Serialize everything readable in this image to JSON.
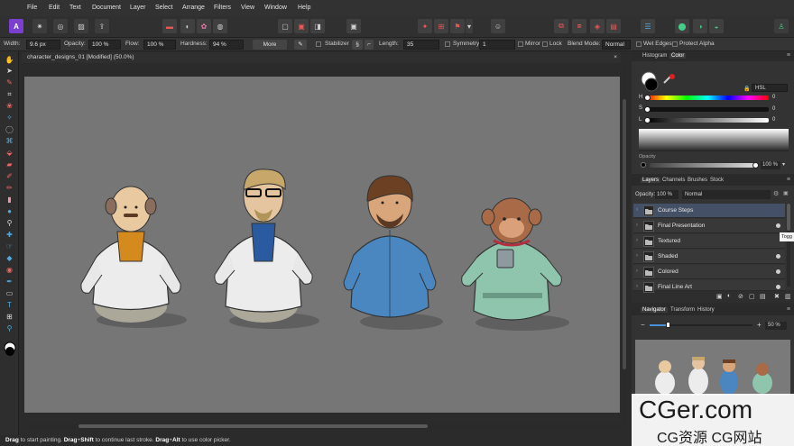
{
  "menu": [
    "File",
    "Edit",
    "Text",
    "Document",
    "Layer",
    "Select",
    "Arrange",
    "Filters",
    "View",
    "Window",
    "Help"
  ],
  "context_toolbar": {
    "width_label": "Width:",
    "width_value": "9.6 px",
    "opacity_label": "Opacity:",
    "opacity_value": "100 %",
    "flow_label": "Flow:",
    "flow_value": "100 %",
    "hardness_label": "Hardness:",
    "hardness_value": "94 %",
    "more_label": "More",
    "stabilizer_label": "Stabilizer",
    "length_label": "Length:",
    "length_value": "35",
    "symmetry_label": "Symmetry",
    "symmetry_value": "1",
    "mirror_label": "Mirror",
    "lock_label": "Lock",
    "blend_label": "Blend Mode:",
    "blend_value": "Normal",
    "wet_edges_label": "Wet Edges",
    "protect_alpha_label": "Protect Alpha"
  },
  "document": {
    "tab_title": "character_designs_01 [Modified] (50.0%)",
    "close": "×"
  },
  "status_bar": {
    "b1": "Drag",
    "t1": " to start painting. ",
    "b2": "Drag",
    "t2": "+",
    "b3": "Shift",
    "t3": " to continue last stroke. ",
    "b4": "Drag",
    "t4": "+",
    "b5": "Alt",
    "t5": " to use color picker."
  },
  "color_panel": {
    "tabs": [
      "Histogram",
      "Color"
    ],
    "active_tab": "Color",
    "model": "HSL",
    "h_label": "H",
    "h_value": "0",
    "s_label": "S",
    "s_value": "0",
    "l_label": "L",
    "l_value": "0",
    "opacity_label": "Opacity",
    "opacity_value": "100 %",
    "opacity_fraction": 1.0,
    "fill_color": "#ffffff",
    "stroke_color": "#000000",
    "accent_color": "#e02020"
  },
  "layers_panel": {
    "tabs": [
      "Layers",
      "Channels",
      "Brushes",
      "Stock"
    ],
    "active_tab": "Layers",
    "opacity_label": "Opacity:",
    "opacity_value": "100 %",
    "blend_value": "Normal",
    "layers": [
      {
        "name": "Course Steps",
        "selected": true
      },
      {
        "name": "Final Presentation",
        "selected": false
      },
      {
        "name": "Textured",
        "selected": false
      },
      {
        "name": "Shaded",
        "selected": false
      },
      {
        "name": "Colored",
        "selected": false
      },
      {
        "name": "Final Line Art",
        "selected": false
      }
    ],
    "tooltip": "Togg"
  },
  "navigator_panel": {
    "tabs": [
      "Navigator",
      "Transform",
      "History"
    ],
    "active_tab": "Navigator",
    "zoom_value": "50 %",
    "zoom_minus": "−",
    "zoom_plus": "+"
  },
  "watermark": {
    "line1": "CGer.com",
    "line2": "CG资源 CG网站"
  },
  "icons": {
    "panel_menu": "≡",
    "expand": "›",
    "folder": "folder-icon",
    "eye": "visibility-icon"
  }
}
